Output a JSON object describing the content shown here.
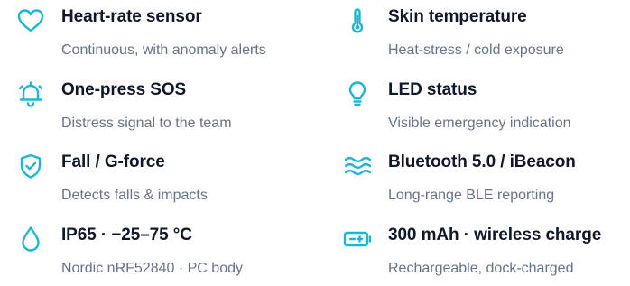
{
  "accent_color": "#1cb8d3",
  "features": [
    {
      "icon": "heart-icon",
      "title": "Heart-rate sensor",
      "description": "Continuous, with anomaly alerts"
    },
    {
      "icon": "thermometer-icon",
      "title": "Skin temperature",
      "description": "Heat-stress / cold exposure"
    },
    {
      "icon": "alarm-bell-icon",
      "title": "One-press SOS",
      "description": "Distress signal to the team"
    },
    {
      "icon": "lightbulb-icon",
      "title": "LED status",
      "description": "Visible emergency indication"
    },
    {
      "icon": "shield-check-icon",
      "title": "Fall / G-force",
      "description": "Detects falls & impacts"
    },
    {
      "icon": "waves-icon",
      "title": "Bluetooth 5.0 / iBeacon",
      "description": "Long-range BLE reporting"
    },
    {
      "icon": "droplet-icon",
      "title": "IP65 · −25–75 °C",
      "description": "Nordic nRF52840 · PC body"
    },
    {
      "icon": "battery-charging-icon",
      "title": "300 mAh · wireless charge",
      "description": "Rechargeable, dock-charged"
    }
  ]
}
